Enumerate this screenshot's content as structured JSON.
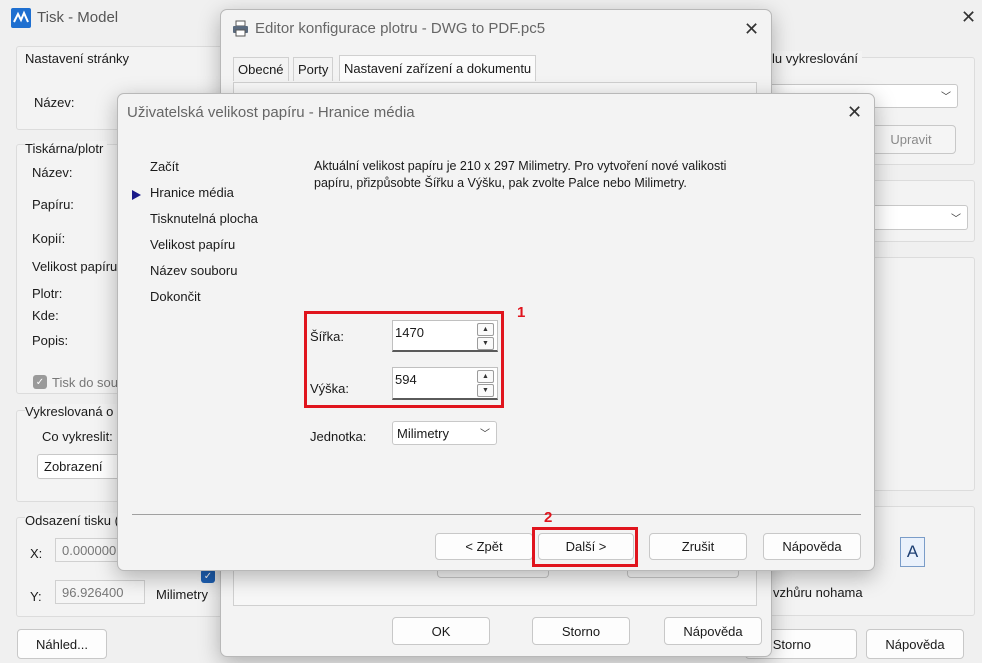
{
  "main_window": {
    "title": "Tisk - Model",
    "page_setup_group": "Nastavení stránky",
    "name_label": "Název:",
    "printer_group": "Tiskárna/plotr",
    "printer_name_label": "Název:",
    "paper_label": "Papíru:",
    "copies_label": "Kopií:",
    "paper_size_label": "Velikost papíru",
    "plotter_label": "Plotr:",
    "where_label": "Kde:",
    "description_label": "Popis:",
    "print_to_file_label": "Tisk do sou",
    "plot_area_group": "Vykreslovaná o",
    "what_to_plot_label": "Co vykreslit:",
    "what_to_plot_value": "Zobrazení",
    "offset_group": "Odsazení tisku (",
    "x_label": "X:",
    "x_value": "0.000000",
    "y_label": "Y:",
    "y_value": "96.926400",
    "offset_unit": "Milimetry",
    "plot_style_group": "lu vykreslování",
    "edit_button": "Upravit",
    "upside_down_label": "vzhůru nohama",
    "orientation_icon_letter": "A",
    "preview_button": "Náhled...",
    "cancel_button": "Storno",
    "help_button": "Nápověda"
  },
  "plotter_editor": {
    "title": "Editor konfigurace plotru - DWG to PDF.pc5",
    "tabs": [
      "Obecné",
      "Porty",
      "Nastavení zařízení a dokumentu"
    ],
    "ok_button": "OK",
    "cancel_button": "Storno",
    "help_button": "Nápověda"
  },
  "wizard": {
    "title": "Uživatelská velikost papíru - Hranice média",
    "steps": [
      "Začít",
      "Hranice média",
      "Tisknutelná plocha",
      "Velikost papíru",
      "Název souboru",
      "Dokončit"
    ],
    "current_step_index": 1,
    "description": "Aktuální velikost papíru je 210 x 297 Milimetry. Pro vytvoření nové valikosti papíru, přizpůsobte Šířku a Výšku, pak zvolte Palce nebo Milimetry.",
    "width_label": "Šířka:",
    "width_value": "1470",
    "height_label": "Výška:",
    "height_value": "594",
    "unit_label": "Jednotka:",
    "unit_value": "Milimetry",
    "back_button": "< Zpět",
    "next_button": "Další >",
    "cancel_button": "Zrušit",
    "help_button": "Nápověda"
  },
  "annotations": {
    "marker_1": "1",
    "marker_2": "2",
    "color": "#e0141d"
  },
  "icons": {
    "app": "autocad-icon",
    "printer": "printer-icon"
  }
}
